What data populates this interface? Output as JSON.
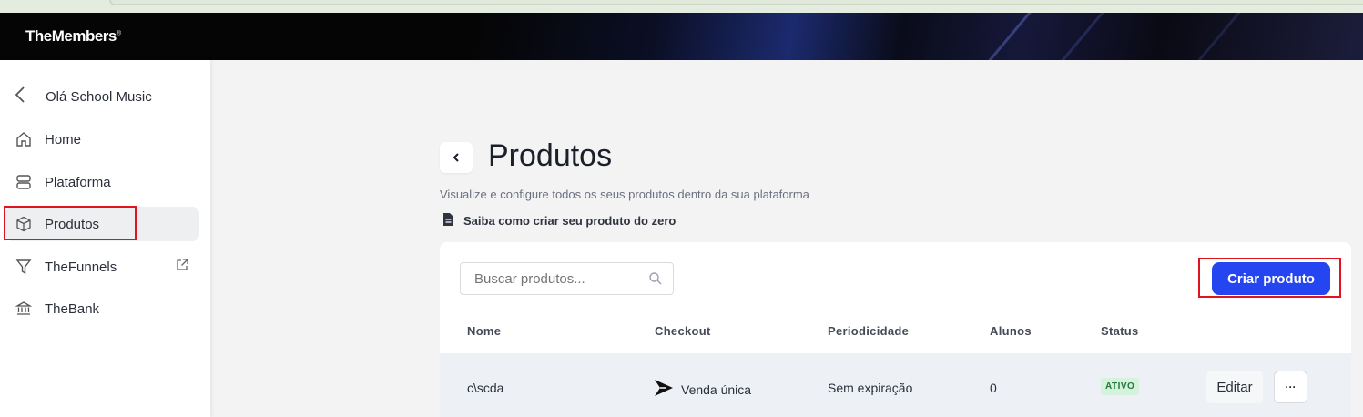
{
  "app": {
    "logo": "TheMembers",
    "logo_mark": "®"
  },
  "sidebar": {
    "back_label": "Olá School Music",
    "items": [
      {
        "label": "Home",
        "icon": "home-icon"
      },
      {
        "label": "Plataforma",
        "icon": "platform-icon"
      },
      {
        "label": "Produtos",
        "icon": "box-icon",
        "active": true
      },
      {
        "label": "TheFunnels",
        "icon": "funnel-icon",
        "external": true
      },
      {
        "label": "TheBank",
        "icon": "bank-icon"
      }
    ]
  },
  "main": {
    "title": "Produtos",
    "subtitle": "Visualize e configure todos os seus produtos dentro da sua plataforma",
    "help_link": "Saiba como criar seu produto do zero",
    "search_placeholder": "Buscar produtos...",
    "create_button": "Criar produto",
    "table": {
      "columns": [
        "Nome",
        "Checkout",
        "Periodicidade",
        "Alunos",
        "Status"
      ],
      "rows": [
        {
          "nome": "c\\scda",
          "checkout": "Venda única",
          "periodicidade": "Sem expiração",
          "alunos": "0",
          "status": "ATIVO",
          "edit": "Editar",
          "more": "···"
        }
      ]
    }
  },
  "colors": {
    "accent": "#2545f0",
    "highlight": "#e0141e",
    "status_active_bg": "#d5f2dc"
  }
}
